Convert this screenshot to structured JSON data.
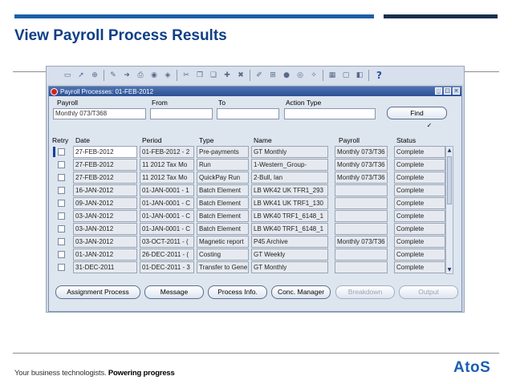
{
  "slide": {
    "title": "View Payroll Process Results",
    "tagline_regular": "Your business technologists.",
    "tagline_bold": "Powering progress",
    "logo_text": "AtoS",
    "colors": {
      "accent_blue": "#1b5fa8",
      "dark_navy": "#1a2e4f",
      "title": "#0f3f86"
    }
  },
  "toolbar": {
    "icons": [
      "open-icon",
      "navigate-icon",
      "zoom-icon",
      "save-icon",
      "next-step-icon",
      "print-icon",
      "close-form-icon",
      "clear-icon",
      "cut-icon",
      "copy-icon",
      "paste-icon",
      "new-record-icon",
      "delete-record-icon",
      "edit-field-icon",
      "attachments-icon",
      "folder-icon",
      "translations-icon",
      "window-icon",
      "help-icon"
    ]
  },
  "window": {
    "title": "Payroll Processes: 01-FEB-2012",
    "search": {
      "payroll_label": "Payroll",
      "payroll_value": "Monthly 073/T368",
      "from_label": "From",
      "from_value": "",
      "to_label": "To",
      "to_value": "",
      "action_type_label": "Action Type",
      "action_type_value": "",
      "find_button": "Find"
    },
    "columns": {
      "retry": "Retry",
      "date": "Date",
      "period": "Period",
      "type": "Type",
      "name": "Name",
      "payroll": "Payroll",
      "status": "Status"
    },
    "rows": [
      {
        "date": "27-FEB-2012",
        "period": "01-FEB-2012 - 2",
        "type": "Pre-payments",
        "name": "GT Monthly",
        "payroll": "Monthly 073/T36",
        "status": "Complete"
      },
      {
        "date": "27-FEB-2012",
        "period": "11 2012 Tax Mo",
        "type": "Run",
        "name": "1-Western_Group-",
        "payroll": "Monthly 073/T36",
        "status": "Complete"
      },
      {
        "date": "27-FEB-2012",
        "period": "11 2012 Tax Mo",
        "type": "QuickPay Run",
        "name": "2-Bull, Ian",
        "payroll": "Monthly 073/T36",
        "status": "Complete"
      },
      {
        "date": "16-JAN-2012",
        "period": "01-JAN-0001 - 1",
        "type": "Batch Element",
        "name": "LB WK42 UK TFR1_293",
        "payroll": "",
        "status": "Complete"
      },
      {
        "date": "09-JAN-2012",
        "period": "01-JAN-0001 - C",
        "type": "Batch Element",
        "name": "LB WK41 UK TRF1_130",
        "payroll": "",
        "status": "Complete"
      },
      {
        "date": "03-JAN-2012",
        "period": "01-JAN-0001 - C",
        "type": "Batch Element",
        "name": "LB WK40 TRF1_6148_1",
        "payroll": "",
        "status": "Complete"
      },
      {
        "date": "03-JAN-2012",
        "period": "01-JAN-0001 - C",
        "type": "Batch Element",
        "name": "LB WK40 TRF1_6148_1",
        "payroll": "",
        "status": "Complete"
      },
      {
        "date": "03-JAN-2012",
        "period": "03-OCT-2011 - (",
        "type": "Magnetic report",
        "name": "P45 Archive",
        "payroll": "Monthly 073/T36",
        "status": "Complete"
      },
      {
        "date": "01-JAN-2012",
        "period": "26-DEC-2011 - (",
        "type": "Costing",
        "name": "GT Weekly",
        "payroll": "",
        "status": "Complete"
      },
      {
        "date": "31-DEC-2011",
        "period": "01-DEC-2011 - 3",
        "type": "Transfer to Gene",
        "name": "GT Monthly",
        "payroll": "",
        "status": "Complete"
      }
    ],
    "buttons": {
      "assignment_process": "Assignment Process",
      "message": "Message",
      "process_info": "Process Info.",
      "conc_manager": "Conc. Manager",
      "breakdown": "Breakdown",
      "output": "Output"
    }
  }
}
